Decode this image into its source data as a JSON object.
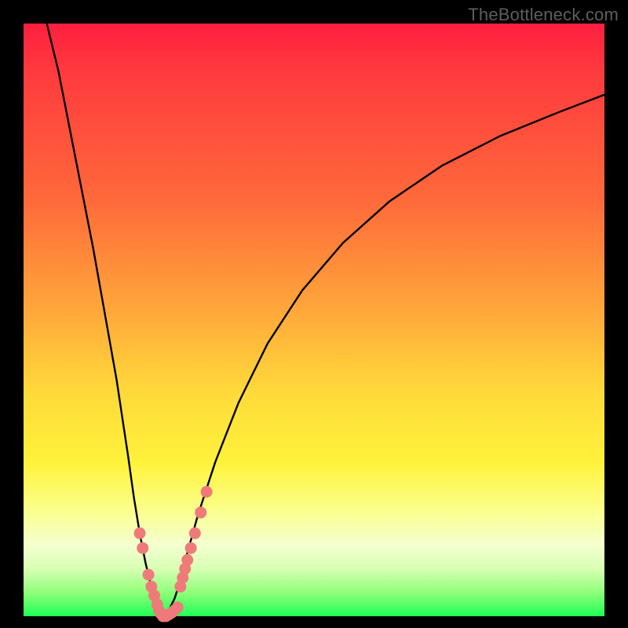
{
  "watermark": "TheBottleneck.com",
  "colors": {
    "frame": "#000000",
    "curve": "#000000",
    "marker": "#ef7a7a",
    "gradient_top": "#ff1f3f",
    "gradient_bottom": "#1eff55"
  },
  "chart_data": {
    "type": "line",
    "title": "",
    "xlabel": "",
    "ylabel": "",
    "xlim": [
      0,
      100
    ],
    "ylim": [
      0,
      100
    ],
    "left_branch": {
      "x": [
        4,
        6,
        8,
        10,
        12,
        14,
        16,
        18,
        19,
        20,
        21,
        22,
        23,
        23.5,
        24
      ],
      "y": [
        100,
        92,
        82,
        72,
        62,
        51,
        40,
        27,
        20,
        14,
        9,
        5,
        2,
        0.5,
        0
      ]
    },
    "right_branch": {
      "x": [
        24,
        25,
        26,
        27,
        28,
        30,
        33,
        37,
        42,
        48,
        55,
        63,
        72,
        82,
        92,
        100
      ],
      "y": [
        0,
        1,
        3,
        6,
        10,
        17,
        26,
        36,
        46,
        55,
        63,
        70,
        76,
        81,
        85,
        88
      ]
    },
    "markers_left": {
      "x": [
        20.0,
        20.5,
        21.5,
        22.0,
        22.5,
        23.0,
        23.3,
        23.6
      ],
      "y": [
        14.0,
        11.5,
        7.0,
        5.0,
        3.5,
        2.0,
        1.0,
        0.5
      ]
    },
    "markers_bottom": {
      "x": [
        24.0,
        24.5,
        25.0,
        25.5,
        26.0,
        26.5
      ],
      "y": [
        0.0,
        0.0,
        0.3,
        0.6,
        1.0,
        1.5
      ]
    },
    "markers_right": {
      "x": [
        27.0,
        27.4,
        27.8,
        28.2,
        28.8,
        29.5,
        30.5,
        31.5
      ],
      "y": [
        5.0,
        6.5,
        8.0,
        9.5,
        11.5,
        14.0,
        17.5,
        21.0
      ]
    }
  }
}
